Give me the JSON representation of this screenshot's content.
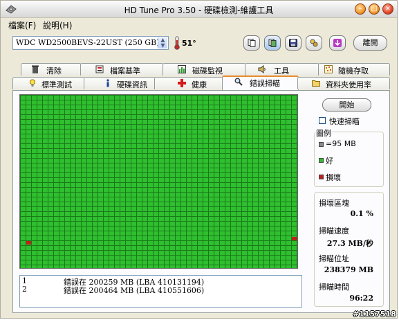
{
  "window": {
    "title": "HD Tune Pro 3.50 - 硬碟檢測-維護工具",
    "min_glyph": "–",
    "max_glyph": "□",
    "close_glyph": "×"
  },
  "menu": {
    "file": "檔案(F)",
    "help": "說明(H)"
  },
  "toolbar": {
    "drive": "WDC WD2500BEVS-22UST (250 GB)",
    "temperature": "51°",
    "exit_label": "離開",
    "buttons": [
      "copy-text-icon",
      "copy-screenshot-icon",
      "save-icon",
      "options-icon",
      "download-icon"
    ]
  },
  "tabs": {
    "row1": [
      "清除",
      "檔案基準",
      "磁碟監視",
      "工具",
      "隨機存取"
    ],
    "row2": [
      "標準測試",
      "硬碟資訊",
      "健康",
      "錯誤掃瞄",
      "資料夾使用率"
    ],
    "active": "錯誤掃瞄"
  },
  "scan": {
    "start_label": "開始",
    "quick_scan_label": "快速掃瞄",
    "quick_scan_checked": false,
    "legend_title": "圖例",
    "legend": [
      {
        "label": "=95 MB",
        "color": "#8a8a8a"
      },
      {
        "label": "好",
        "color": "#2fbf2f"
      },
      {
        "label": "損壞",
        "color": "#c21e1e"
      }
    ],
    "stats": [
      {
        "label": "損壞區塊",
        "value": "0.1 %"
      },
      {
        "label": "掃瞄速度",
        "value": "27.3 MB/秒"
      },
      {
        "label": "掃瞄位址",
        "value": "238379 MB"
      },
      {
        "label": "掃瞄時間",
        "value": "96:22"
      }
    ]
  },
  "log": [
    {
      "n": "1",
      "text": "錯誤在 200259 MB (LBA 410131194)"
    },
    {
      "n": "2",
      "text": "錯誤在 200464 MB (LBA 410551606)"
    }
  ],
  "watermark": "#1157518"
}
